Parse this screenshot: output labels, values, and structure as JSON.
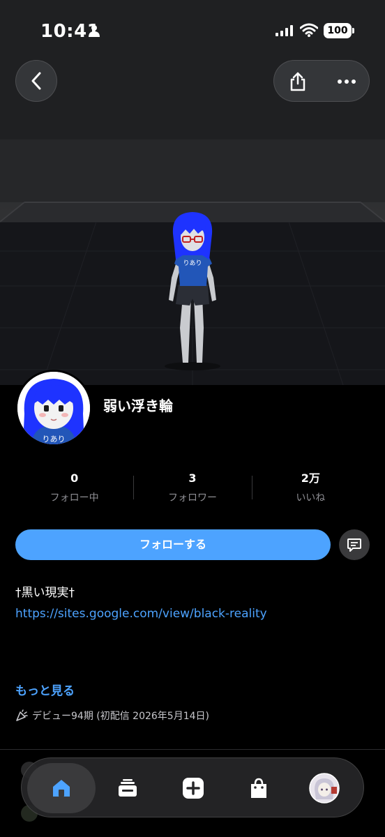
{
  "status_bar": {
    "time": "10:41",
    "battery": "100"
  },
  "nav": {
    "back_icon": "chevron-left-icon",
    "share_icon": "share-icon",
    "more_icon": "ellipsis-icon"
  },
  "profile": {
    "name": "弱い浮き輪",
    "stats": [
      {
        "value": "0",
        "label": "フォロー中"
      },
      {
        "value": "3",
        "label": "フォロワー"
      },
      {
        "value": "2万",
        "label": "いいね"
      }
    ],
    "follow_label": "フォローする",
    "bio_line": "†黒い現実†",
    "bio_url": "https://sites.google.com/view/black-reality",
    "more_label": "もっと見る",
    "debut_text": "デビュー94期 (初配信 2026年5月14日)",
    "avatar_shirt_text": "りあり"
  },
  "tab_bar": {
    "items": [
      "home-icon",
      "feed-icon",
      "add-icon",
      "shop-icon",
      "profile-avatar"
    ]
  },
  "colors": {
    "accent": "#4da3ff",
    "background": "#000000",
    "hair": "#1e33ff",
    "shirt": "#2256b8"
  }
}
